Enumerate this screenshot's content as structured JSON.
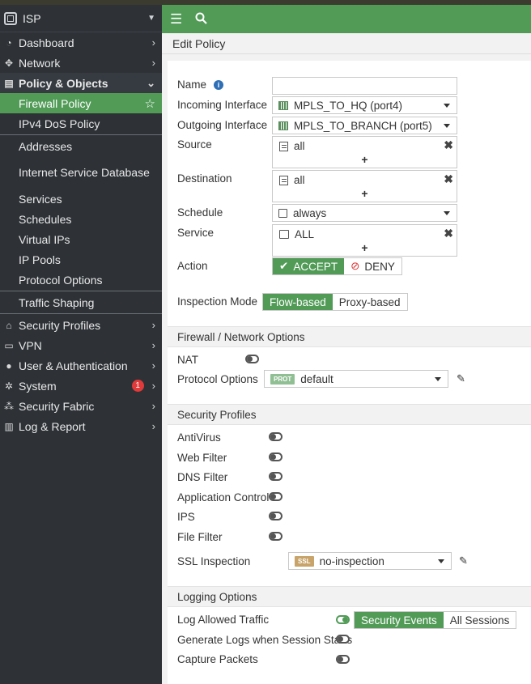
{
  "sidebar": {
    "header": {
      "title": "ISP"
    },
    "items": [
      {
        "label": "Dashboard"
      },
      {
        "label": "Network"
      },
      {
        "label": "Policy & Objects"
      },
      {
        "label": "Security Profiles"
      },
      {
        "label": "VPN"
      },
      {
        "label": "User & Authentication"
      },
      {
        "label": "System",
        "badge": "1"
      },
      {
        "label": "Security Fabric"
      },
      {
        "label": "Log & Report"
      }
    ],
    "sub_items": [
      {
        "label": "Firewall Policy"
      },
      {
        "label": "IPv4 DoS Policy"
      },
      {
        "label": "Addresses"
      },
      {
        "label": "Internet Service Database"
      },
      {
        "label": "Services"
      },
      {
        "label": "Schedules"
      },
      {
        "label": "Virtual IPs"
      },
      {
        "label": "IP Pools"
      },
      {
        "label": "Protocol Options"
      },
      {
        "label": "Traffic Shaping"
      }
    ]
  },
  "page": {
    "title": "Edit Policy"
  },
  "form": {
    "name": {
      "label": "Name",
      "value": ""
    },
    "incoming": {
      "label": "Incoming Interface",
      "value": "MPLS_TO_HQ (port4)"
    },
    "outgoing": {
      "label": "Outgoing Interface",
      "value": "MPLS_TO_BRANCH (port5)"
    },
    "source": {
      "label": "Source",
      "value": "all"
    },
    "destination": {
      "label": "Destination",
      "value": "all"
    },
    "schedule": {
      "label": "Schedule",
      "value": "always"
    },
    "service": {
      "label": "Service",
      "value": "ALL"
    },
    "action": {
      "label": "Action",
      "accept": "ACCEPT",
      "deny": "DENY",
      "selected": "ACCEPT"
    },
    "inspection": {
      "label": "Inspection Mode",
      "flow": "Flow-based",
      "proxy": "Proxy-based",
      "selected": "Flow-based"
    }
  },
  "firewall_options": {
    "title": "Firewall / Network Options",
    "nat": {
      "label": "NAT",
      "enabled": false
    },
    "protocol_options": {
      "label": "Protocol Options",
      "tag": "PROT",
      "value": "default"
    }
  },
  "security_profiles": {
    "title": "Security Profiles",
    "items": [
      {
        "label": "AntiVirus",
        "enabled": false
      },
      {
        "label": "Web Filter",
        "enabled": false
      },
      {
        "label": "DNS Filter",
        "enabled": false
      },
      {
        "label": "Application Control",
        "enabled": false
      },
      {
        "label": "IPS",
        "enabled": false
      },
      {
        "label": "File Filter",
        "enabled": false
      }
    ],
    "ssl": {
      "label": "SSL Inspection",
      "tag": "SSL",
      "value": "no-inspection"
    }
  },
  "logging": {
    "title": "Logging Options",
    "log_allowed": {
      "label": "Log Allowed Traffic",
      "enabled": true,
      "option_security": "Security Events",
      "option_all": "All Sessions",
      "selected": "Security Events"
    },
    "generate_logs": {
      "label": "Generate Logs when Session Starts",
      "enabled": false
    },
    "capture_packets": {
      "label": "Capture Packets",
      "enabled": false
    }
  },
  "colors": {
    "accent": "#519b57",
    "sidebar": "#2e3237",
    "badge": "#e03a3a",
    "prot_tag": "#8fbf93",
    "ssl_tag": "#c8a46a"
  }
}
